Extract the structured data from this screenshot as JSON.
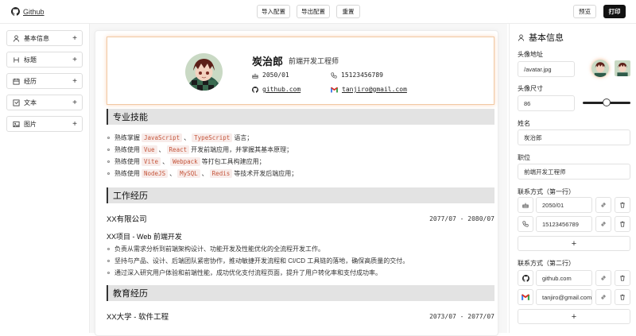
{
  "topbar": {
    "github": "Github",
    "import_config": "导入配置",
    "export_config": "导出配置",
    "reset": "重置",
    "preview": "预览",
    "print": "打印"
  },
  "sidebar": {
    "items": [
      {
        "label": "基本信息",
        "icon": "user-icon"
      },
      {
        "label": "标题",
        "icon": "heading-icon"
      },
      {
        "label": "经历",
        "icon": "calendar-icon"
      },
      {
        "label": "文本",
        "icon": "text-icon"
      },
      {
        "label": "图片",
        "icon": "image-icon"
      }
    ]
  },
  "resume": {
    "name": "炭治郎",
    "role": "前端开发工程师",
    "contacts": [
      {
        "icon": "cake-icon",
        "text": "2050/01"
      },
      {
        "icon": "phone-icon",
        "text": "15123456789"
      },
      {
        "icon": "github-icon",
        "text": "github.com"
      },
      {
        "icon": "gmail-icon",
        "text": "tanjiro@gmail.com"
      }
    ],
    "skills_title": "专业技能",
    "skills": [
      {
        "parts": [
          "熟练掌握 ",
          "JavaScript",
          " 、 ",
          "TypeScript",
          " 语言；"
        ]
      },
      {
        "parts": [
          "熟练使用 ",
          "Vue",
          " 、 ",
          "React",
          " 开发前端应用，并掌握其基本原理；"
        ]
      },
      {
        "parts": [
          "熟练使用 ",
          "Vite",
          " 、 ",
          "Webpack",
          " 等打包工具构建应用；"
        ]
      },
      {
        "parts": [
          "熟练使用 ",
          "NodeJS",
          " 、 ",
          "MySQL",
          " 、 ",
          "Redis",
          " 等技术开发后端应用；"
        ]
      }
    ],
    "work_title": "工作经历",
    "work": {
      "company": "XX有限公司",
      "date": "2077/07 - 2080/07",
      "project": "XX项目 - Web 前端开发",
      "bullets": [
        "负责从需求分析到前端架构设计、功能开发及性能优化的全流程开发工作。",
        "坚持与产品、设计、后端团队紧密协作，推动敏捷开发流程和 CI/CD 工具链的落地，确保高质量的交付。",
        "通过深入研究用户体验和前端性能，成功优化支付流程页面，提升了用户转化率和支付成功率。"
      ]
    },
    "edu_title": "教育经历",
    "edu": {
      "school": "XX大学 - 软件工程",
      "date": "2073/07 - 2077/07"
    }
  },
  "panel": {
    "title": "基本信息",
    "avatar_label": "头像地址",
    "avatar_value": "/avatar.jpg",
    "size_label": "头像尺寸",
    "size_value": "86",
    "size_fraction": 0.5,
    "name_label": "姓名",
    "name_value": "炭治郎",
    "role_label": "职位",
    "role_value": "前端开发工程师",
    "contact1_label": "联系方式（第一行）",
    "contact1": [
      {
        "icon": "cake-icon",
        "value": "2050/01"
      },
      {
        "icon": "phone-icon",
        "value": "15123456789"
      }
    ],
    "contact2_label": "联系方式（第二行）",
    "contact2": [
      {
        "icon": "github-icon",
        "value": "github.com"
      },
      {
        "icon": "gmail-icon",
        "value": "tanjiro@gmail.com"
      }
    ],
    "add": "+"
  }
}
